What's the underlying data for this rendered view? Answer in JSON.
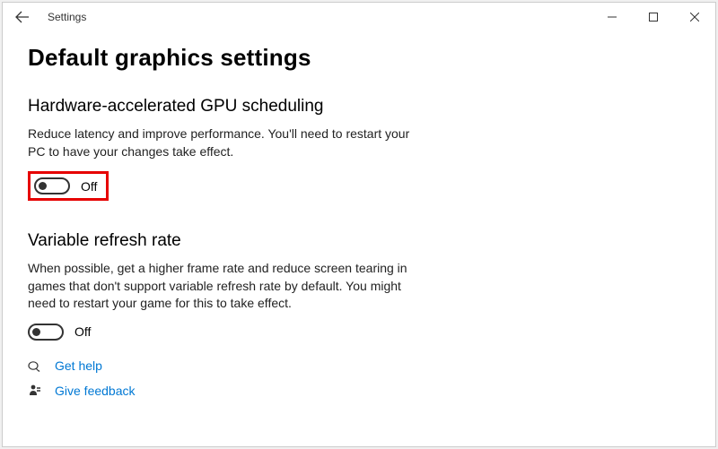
{
  "titlebar": {
    "app_name": "Settings"
  },
  "page": {
    "title": "Default graphics settings"
  },
  "section_gpu": {
    "heading": "Hardware-accelerated GPU scheduling",
    "description": "Reduce latency and improve performance. You'll need to restart your PC to have your changes take effect.",
    "toggle_state": "Off"
  },
  "section_vrr": {
    "heading": "Variable refresh rate",
    "description": "When possible, get a higher frame rate and reduce screen tearing in games that don't support variable refresh rate by default. You might need to restart your game for this to take effect.",
    "toggle_state": "Off"
  },
  "links": {
    "help": "Get help",
    "feedback": "Give feedback"
  },
  "colors": {
    "link": "#0078d4",
    "highlight_border": "#e60000"
  }
}
